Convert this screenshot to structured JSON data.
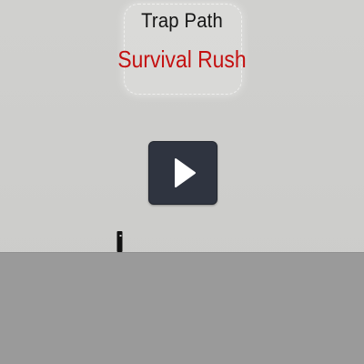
{
  "game": {
    "title_line_1": "Trap Path",
    "title_line_2": "Survival Rush"
  },
  "controls": {
    "play_icon": "play-icon"
  },
  "colors": {
    "background": "#cfcfcd",
    "ground": "#9a9a9a",
    "title_dark": "#141414",
    "title_red": "#c41010",
    "button": "#2f3440",
    "player": "#111111"
  }
}
